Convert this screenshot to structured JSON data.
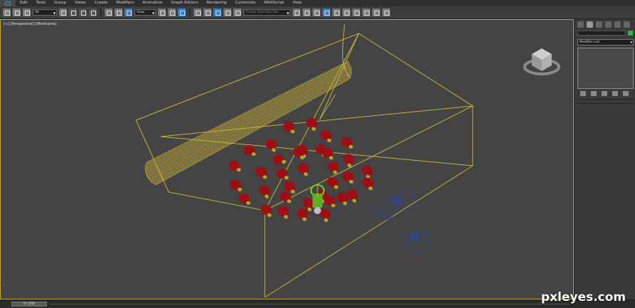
{
  "menubar": {
    "items": [
      "Edit",
      "Tools",
      "Group",
      "Views",
      "Create",
      "Modifiers",
      "Animation",
      "Graph Editors",
      "Rendering",
      "Customize",
      "MAXScript",
      "Help"
    ]
  },
  "toolbar": {
    "selection_filter": "All",
    "reference_coord": "View",
    "named_selection": "Create Selection Set"
  },
  "viewport": {
    "label": "[+] [Perspective] [Wireframe]"
  },
  "command_panel": {
    "modifier_list": "Modifier List",
    "object_color": "#2db34a"
  },
  "timeline": {
    "frame_display": "0 / 250"
  },
  "watermark": "pxleyes.com",
  "colors": {
    "selection_yellow": "#c9b13a",
    "bulb_red": "#9d0f14",
    "bulb_base_yellow": "#b8a22a",
    "selected_green": "#7bd12a",
    "light_blue": "#2648a8"
  }
}
